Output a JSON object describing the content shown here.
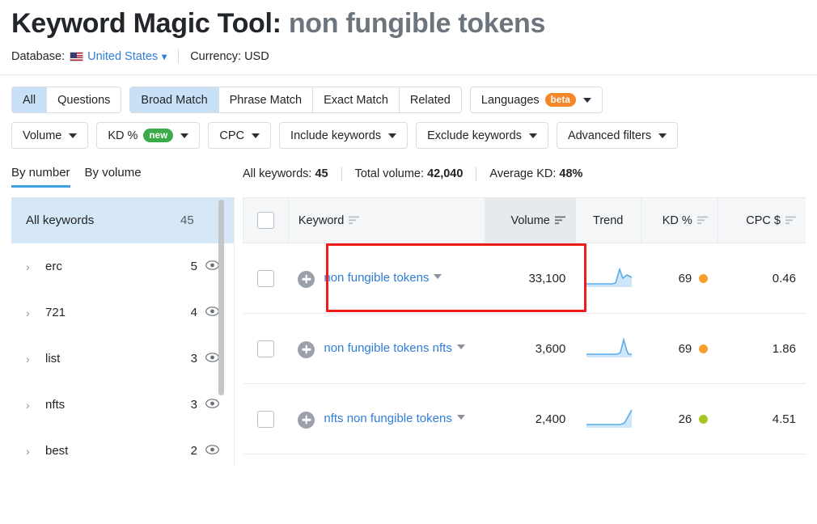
{
  "header": {
    "title_prefix": "Keyword Magic Tool:",
    "title_term": "non fungible tokens",
    "database_label": "Database:",
    "database_value": "United States",
    "currency_text": "Currency: USD",
    "flag_icon": "us-flag-icon"
  },
  "filters": {
    "match_tabs": [
      {
        "label": "All",
        "active": true
      },
      {
        "label": "Questions",
        "active": false
      }
    ],
    "match_types": [
      {
        "label": "Broad Match",
        "active": true
      },
      {
        "label": "Phrase Match",
        "active": false
      },
      {
        "label": "Exact Match",
        "active": false
      },
      {
        "label": "Related",
        "active": false
      }
    ],
    "languages": {
      "label": "Languages",
      "badge": "beta",
      "badge_color": "#f6862a"
    },
    "dropdowns": [
      {
        "label": "Volume",
        "badge": null
      },
      {
        "label": "KD %",
        "badge": "new",
        "badge_color": "#3aab4b"
      },
      {
        "label": "CPC",
        "badge": null
      },
      {
        "label": "Include keywords",
        "badge": null
      },
      {
        "label": "Exclude keywords",
        "badge": null
      },
      {
        "label": "Advanced filters",
        "badge": null
      }
    ]
  },
  "subtabs": [
    {
      "label": "By number",
      "active": true
    },
    {
      "label": "By volume",
      "active": false
    }
  ],
  "stats": [
    {
      "label": "All keywords:",
      "value": "45"
    },
    {
      "label": "Total volume:",
      "value": "42,040"
    },
    {
      "label": "Average KD:",
      "value": "48%"
    }
  ],
  "sidebar": {
    "all_keywords": {
      "label": "All keywords",
      "count": "45"
    },
    "groups": [
      {
        "label": "erc",
        "count": "5"
      },
      {
        "label": "721",
        "count": "4"
      },
      {
        "label": "list",
        "count": "3"
      },
      {
        "label": "nfts",
        "count": "3"
      },
      {
        "label": "best",
        "count": "2"
      }
    ]
  },
  "table": {
    "columns": [
      {
        "key": "check",
        "label": ""
      },
      {
        "key": "keyword",
        "label": "Keyword",
        "sortable": true
      },
      {
        "key": "volume",
        "label": "Volume",
        "sortable": true,
        "active_sort": true
      },
      {
        "key": "trend",
        "label": "Trend",
        "sortable": false
      },
      {
        "key": "kd",
        "label": "KD %",
        "sortable": true
      },
      {
        "key": "cpc",
        "label": "CPC $",
        "sortable": true
      }
    ],
    "rows": [
      {
        "keyword": "non fungible tokens",
        "volume": "33,100",
        "kd": "69",
        "kd_color": "#f8a02e",
        "cpc": "0.46",
        "trend": [
          6,
          6,
          6,
          6,
          6,
          6,
          6,
          6,
          6,
          7,
          30,
          16,
          19
        ],
        "highlighted": true
      },
      {
        "keyword": "non fungible tokens nfts",
        "volume": "3,600",
        "kd": "69",
        "kd_color": "#f8a02e",
        "cpc": "1.86",
        "trend": [
          5,
          5,
          5,
          5,
          5,
          5,
          5,
          5,
          5,
          5,
          6,
          30,
          9
        ],
        "highlighted": false
      },
      {
        "keyword": "nfts non fungible tokens",
        "volume": "2,400",
        "kd": "26",
        "kd_color": "#a5c726",
        "cpc": "4.51",
        "trend": [
          5,
          5,
          5,
          5,
          5,
          5,
          5,
          5,
          5,
          5,
          6,
          14,
          30
        ],
        "highlighted": false
      }
    ]
  },
  "annotation": {
    "color": "#f21b1b",
    "target": "first-row-keyword-and-volume"
  }
}
